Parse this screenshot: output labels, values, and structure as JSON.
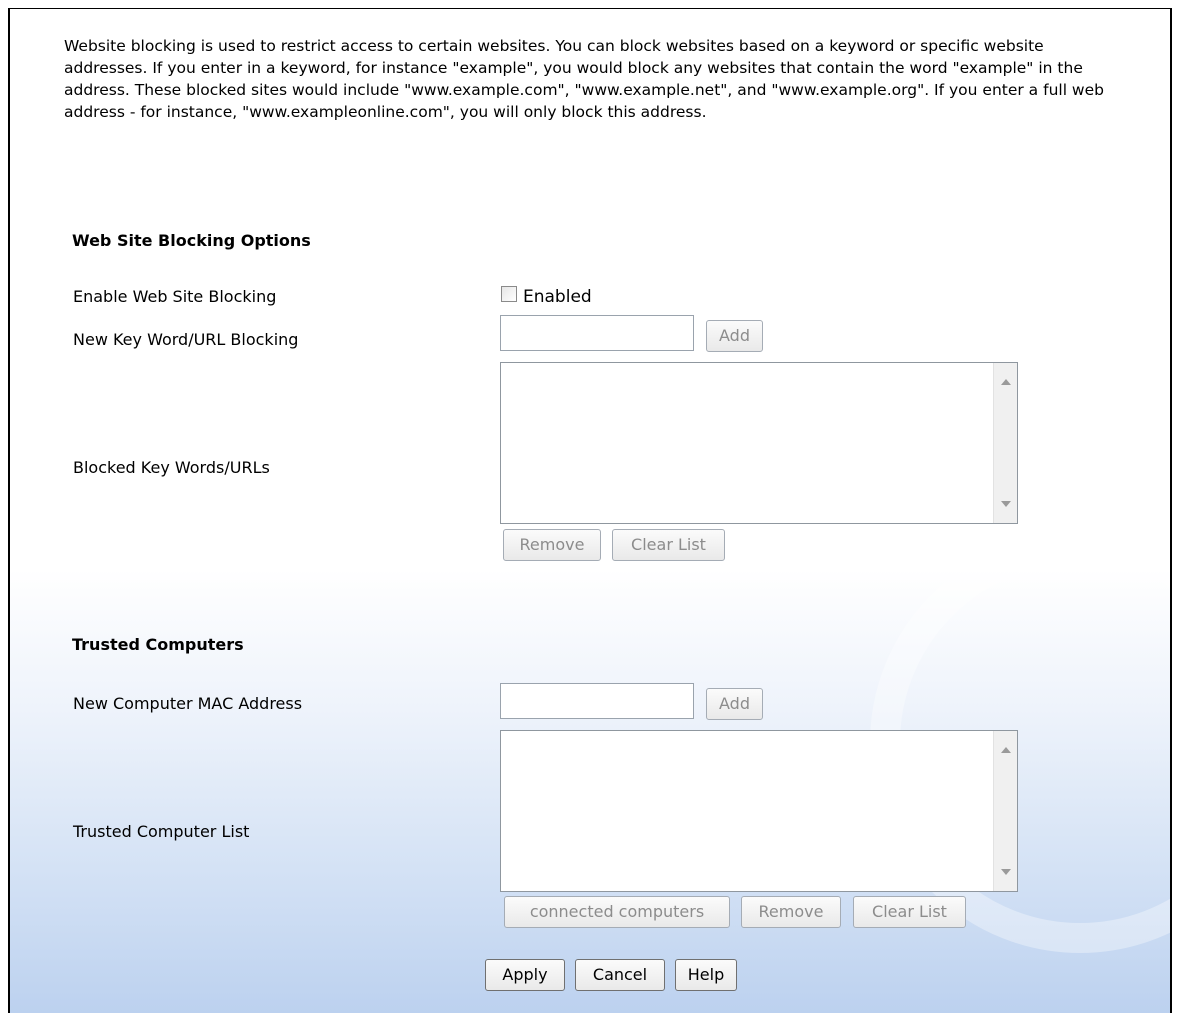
{
  "intro_text": "Website blocking is used to restrict access to certain websites. You can block websites based on a keyword or specific website addresses. If you enter in a keyword, for instance \"example\", you would block any websites that contain the word \"example\" in the address. These blocked sites would include \"www.example.com\", \"www.example.net\", and \"www.example.org\". If you enter a full web address - for instance, \"www.exampleonline.com\", you will only block this address.",
  "web_blocking": {
    "title": "Web Site Blocking Options",
    "enable_label": "Enable Web Site Blocking",
    "enabled_checkbox_label": "Enabled",
    "enabled_checked": false,
    "new_keyword_label": "New Key Word/URL Blocking",
    "new_keyword_value": "",
    "add_label": "Add",
    "blocked_list_label": "Blocked Key Words/URLs",
    "blocked_items": [],
    "remove_label": "Remove",
    "clear_label": "Clear List"
  },
  "trusted": {
    "title": "Trusted Computers",
    "new_mac_label": "New Computer MAC Address",
    "new_mac_value": "",
    "add_label": "Add",
    "list_label": "Trusted Computer List",
    "items": [],
    "connected_label": "connected computers",
    "remove_label": "Remove",
    "clear_label": "Clear List"
  },
  "footer": {
    "apply_label": "Apply",
    "cancel_label": "Cancel",
    "help_label": "Help"
  }
}
